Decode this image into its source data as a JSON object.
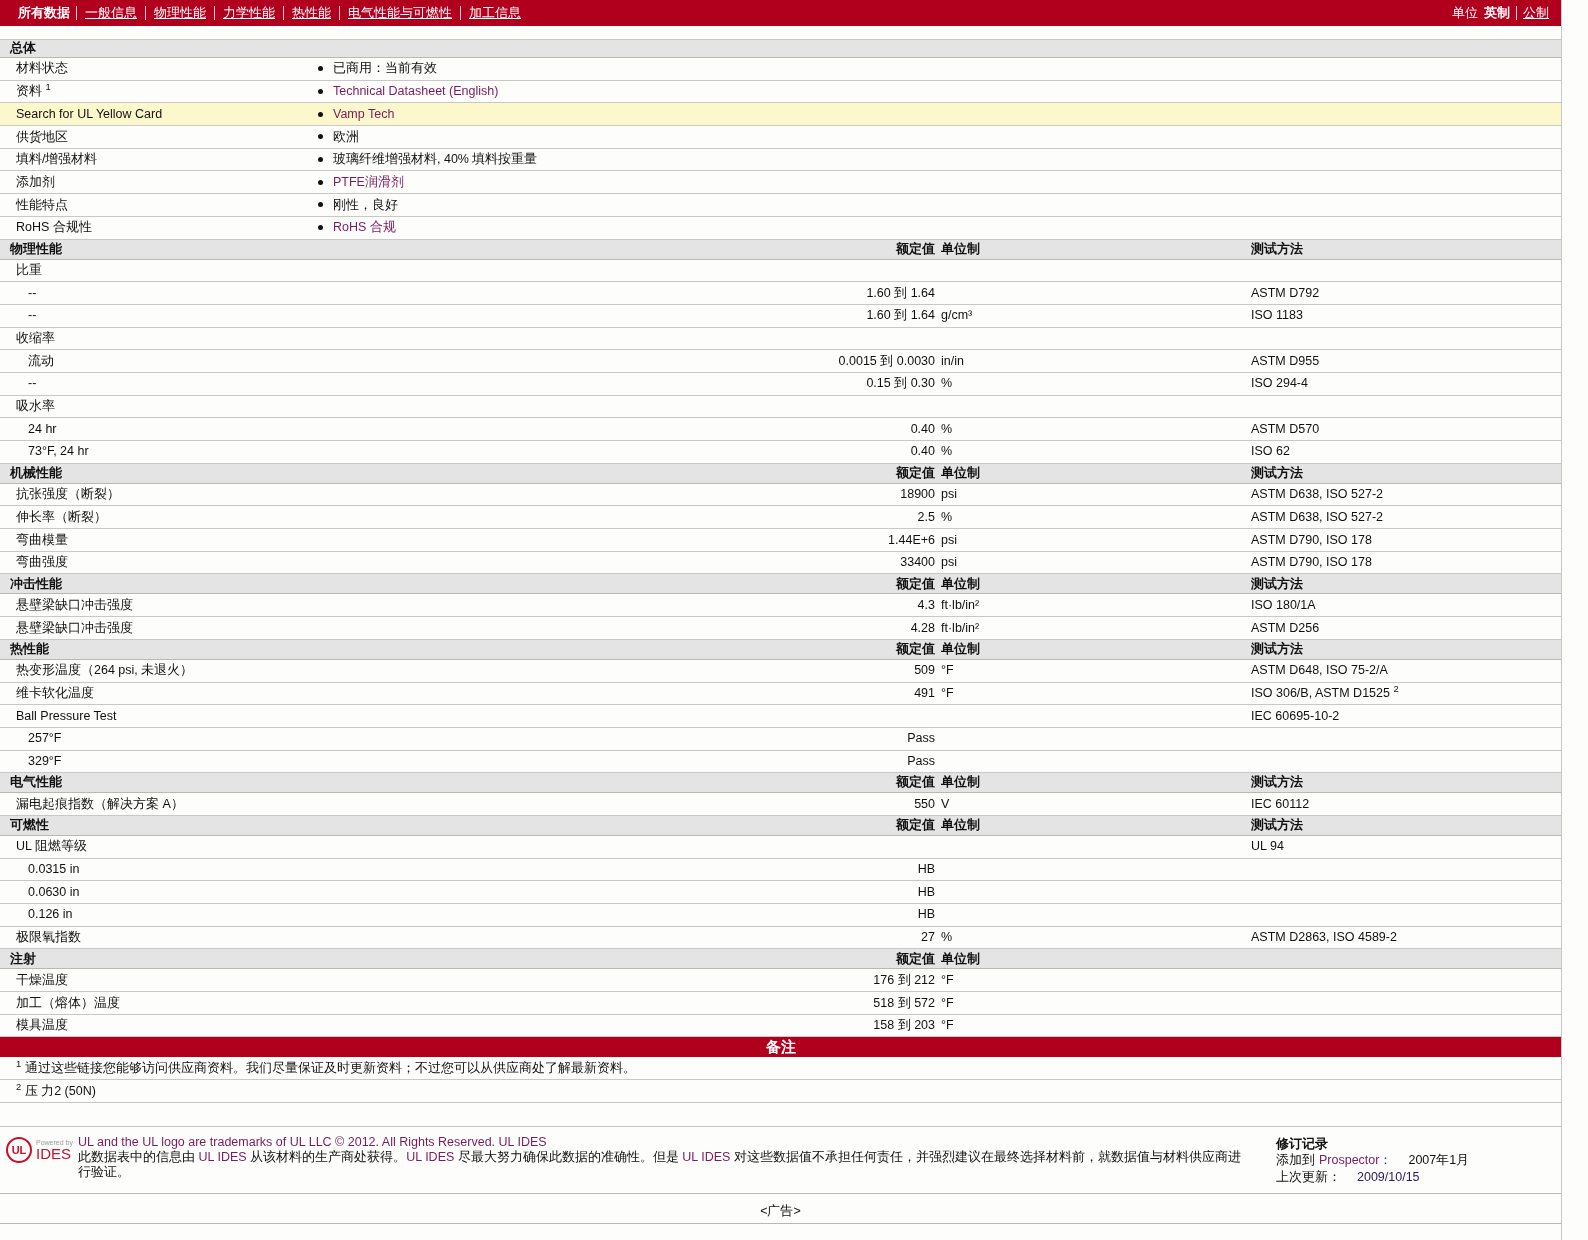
{
  "nav": {
    "tabs": [
      {
        "label": "所有数据",
        "selected": true
      },
      {
        "label": "一般信息",
        "selected": false
      },
      {
        "label": "物理性能",
        "selected": false
      },
      {
        "label": "力学性能",
        "selected": false
      },
      {
        "label": "热性能",
        "selected": false
      },
      {
        "label": "电气性能与可燃性",
        "selected": false
      },
      {
        "label": "加工信息",
        "selected": false
      }
    ],
    "units_label": "单位",
    "units": [
      {
        "label": "英制",
        "selected": true
      },
      {
        "label": "公制",
        "selected": false
      }
    ]
  },
  "general": {
    "title": "总体",
    "rows": [
      {
        "label": "材料状态",
        "value": "已商用：当前有效",
        "link": false,
        "highlighted": false
      },
      {
        "label": "资料 $^{1}$",
        "value": "Technical Datasheet (English)",
        "link": true,
        "highlighted": false
      },
      {
        "label": "Search for UL Yellow Card",
        "value": "Vamp Tech",
        "link": true,
        "highlighted": true
      },
      {
        "label": "供货地区",
        "value": "欧洲",
        "link": false,
        "highlighted": false
      },
      {
        "label": "填料/增强材料",
        "value": "玻璃纤维增强材料, 40% 填料按重量",
        "link": false,
        "highlighted": false
      },
      {
        "label": "添加剂",
        "value": "PTFE润滑剂",
        "link": true,
        "highlighted": false
      },
      {
        "label": "性能特点",
        "value": "刚性，良好",
        "link": false,
        "highlighted": false
      },
      {
        "label": "RoHS 合规性",
        "value": "RoHS 合规",
        "link": true,
        "highlighted": false
      }
    ]
  },
  "sections": [
    {
      "title": "物理性能",
      "value_header": "额定值",
      "unit_header": "单位制",
      "method_header": "测试方法",
      "rows": [
        {
          "kind": "row",
          "label": "比重"
        },
        {
          "kind": "sub",
          "label": "--",
          "value": "1.60 到  1.64",
          "method": "ASTM D792"
        },
        {
          "kind": "sub",
          "label": "--",
          "value": "1.60 到  1.64",
          "unit": "g/cm³",
          "method": "ISO 1183"
        },
        {
          "kind": "row",
          "label": "收缩率"
        },
        {
          "kind": "sub",
          "label": "流动",
          "value": "0.0015 到  0.0030",
          "unit": "in/in",
          "method": "ASTM D955"
        },
        {
          "kind": "sub",
          "label": "--",
          "value": "0.15 到  0.30",
          "unit": "%",
          "method": "ISO 294-4"
        },
        {
          "kind": "row",
          "label": "吸水率"
        },
        {
          "kind": "sub",
          "label": "24 hr",
          "value": "0.40",
          "unit": "%",
          "method": "ASTM D570"
        },
        {
          "kind": "sub",
          "label": "73°F, 24 hr",
          "value": "0.40",
          "unit": "%",
          "method": "ISO 62"
        }
      ]
    },
    {
      "title": "机械性能",
      "value_header": "额定值",
      "unit_header": "单位制",
      "method_header": "测试方法",
      "rows": [
        {
          "kind": "row",
          "label": "抗张强度（断裂）",
          "value": "18900",
          "unit": "psi",
          "method": "ASTM D638, ISO 527-2"
        },
        {
          "kind": "row",
          "label": "伸长率（断裂）",
          "value": "2.5",
          "unit": "%",
          "method": "ASTM D638, ISO 527-2"
        },
        {
          "kind": "row",
          "label": "弯曲模量",
          "value": "1.44E+6",
          "unit": "psi",
          "method": "ASTM D790, ISO 178"
        },
        {
          "kind": "row",
          "label": "弯曲强度",
          "value": "33400",
          "unit": "psi",
          "method": "ASTM D790, ISO 178"
        }
      ]
    },
    {
      "title": "冲击性能",
      "value_header": "额定值",
      "unit_header": "单位制",
      "method_header": "测试方法",
      "rows": [
        {
          "kind": "row",
          "label": "悬壁梁缺口冲击强度",
          "value": "4.3",
          "unit": "ft·lb/in²",
          "method": "ISO 180/1A"
        },
        {
          "kind": "row",
          "label": "悬壁梁缺口冲击强度",
          "value": "4.28",
          "unit": "ft·lb/in²",
          "method": "ASTM D256"
        }
      ]
    },
    {
      "title": "热性能",
      "value_header": "额定值",
      "unit_header": "单位制",
      "method_header": "测试方法",
      "rows": [
        {
          "kind": "row",
          "label": "热变形温度（264 psi, 未退火）",
          "value": "509",
          "unit": "°F",
          "method": "ASTM D648, ISO 75-2/A"
        },
        {
          "kind": "row",
          "label": "维卡软化温度",
          "value": "491",
          "unit": "°F",
          "method": "ISO 306/B, ASTM D1525 $^{2}$"
        },
        {
          "kind": "row",
          "label": "Ball Pressure Test",
          "method": "IEC 60695-10-2"
        },
        {
          "kind": "sub",
          "label": "257°F",
          "value": "Pass"
        },
        {
          "kind": "sub",
          "label": "329°F",
          "value": "Pass"
        }
      ]
    },
    {
      "title": "电气性能",
      "value_header": "额定值",
      "unit_header": "单位制",
      "method_header": "测试方法",
      "rows": [
        {
          "kind": "row",
          "label": "漏电起痕指数（解决方案 A）",
          "value": "550",
          "unit": "V",
          "method": "IEC 60112"
        }
      ]
    },
    {
      "title": "可燃性",
      "value_header": "额定值",
      "unit_header": "单位制",
      "method_header": "测试方法",
      "rows": [
        {
          "kind": "row",
          "label": "UL 阻燃等级",
          "method": "UL 94"
        },
        {
          "kind": "sub",
          "label": "0.0315 in",
          "value": "HB"
        },
        {
          "kind": "sub",
          "label": "0.0630 in",
          "value": "HB"
        },
        {
          "kind": "sub",
          "label": "0.126 in",
          "value": "HB"
        },
        {
          "kind": "row",
          "label": "极限氧指数",
          "value": "27",
          "unit": "%",
          "method": "ASTM D2863, ISO 4589-2"
        }
      ]
    },
    {
      "title": "注射",
      "value_header": "额定值",
      "unit_header": "单位制",
      "rows": [
        {
          "kind": "row",
          "label": "干燥温度",
          "value": "176 到  212",
          "unit": "°F"
        },
        {
          "kind": "row",
          "label": "加工（熔体）温度",
          "value": "518 到  572",
          "unit": "°F"
        },
        {
          "kind": "row",
          "label": "模具温度",
          "value": "158 到  203",
          "unit": "°F"
        }
      ]
    }
  ],
  "notes": {
    "title": "备注",
    "items": [
      "$^{1}$ 通过这些链接您能够访问供应商资料。我们尽量保证及时更新资料；不过您可以从供应商处了解最新资料。",
      "$^{2}$ 压 力2 (50N)"
    ]
  },
  "footer": {
    "logo_caption": "Powered by",
    "logo_word": "IDES",
    "logo_letters": "UL",
    "trademark": "UL and the UL logo are trademarks of UL LLC © 2012. All Rights Reserved.",
    "trademark_link": "UL IDES",
    "disclaimer": [
      {
        "text": "此数据表中的信息由 ",
        "link": false
      },
      {
        "text": "UL IDES",
        "link": true
      },
      {
        "text": " 从该材料的生产商处获得。",
        "link": false
      },
      {
        "text": "UL IDES",
        "link": true
      },
      {
        "text": " 尽最大努力确保此数据的准确性。但是 ",
        "link": false
      },
      {
        "text": "UL IDES",
        "link": true
      },
      {
        "text": " 对这些数据值不承担任何责任，并强烈建议在最终选择材料前，就数据值与材料供应商进行验证。",
        "link": false
      }
    ],
    "revision_title": "修订记录",
    "added_label": "添加到",
    "added_link": "Prospector：",
    "added_value": "2007年1月",
    "updated_label": "上次更新：",
    "updated_value": "2009/10/15"
  },
  "ad": "<广告>"
}
